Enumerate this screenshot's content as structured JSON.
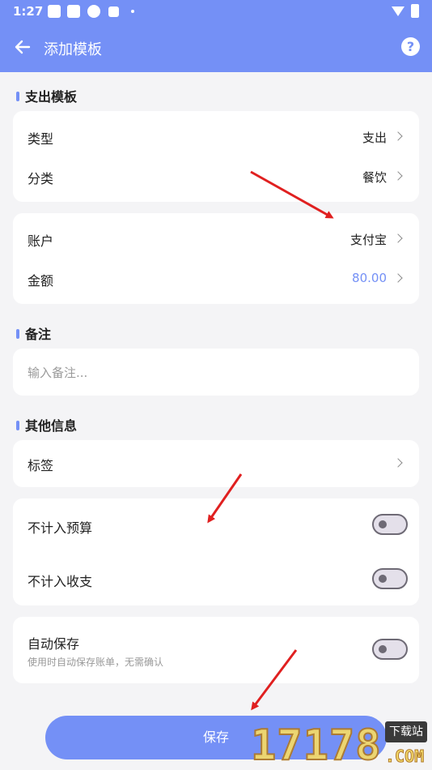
{
  "status_bar": {
    "time": "1:27"
  },
  "nav": {
    "title": "添加模板",
    "help_label": "?"
  },
  "expense_section": {
    "title": "支出模板",
    "type": {
      "label": "类型",
      "value": "支出"
    },
    "category": {
      "label": "分类",
      "value": "餐饮"
    },
    "account": {
      "label": "账户",
      "value": "支付宝"
    },
    "amount": {
      "label": "金额",
      "value": "80.00"
    }
  },
  "note_section": {
    "title": "备注",
    "placeholder": "输入备注..."
  },
  "other_section": {
    "title": "其他信息",
    "tags": {
      "label": "标签"
    },
    "exclude_budget": {
      "label": "不计入预算",
      "checked": false
    },
    "exclude_income_expense": {
      "label": "不计入收支",
      "checked": false
    },
    "auto_save": {
      "label": "自动保存",
      "description": "使用时自动保存账单，无需确认",
      "checked": false
    }
  },
  "save_button": {
    "label": "保存"
  },
  "watermark": {
    "digits": "17178",
    "badge": "下载站",
    "suffix": ".COM"
  },
  "colors": {
    "accent": "#7490f6",
    "background": "#f4f4f6",
    "annotation_arrow": "#e02020"
  }
}
